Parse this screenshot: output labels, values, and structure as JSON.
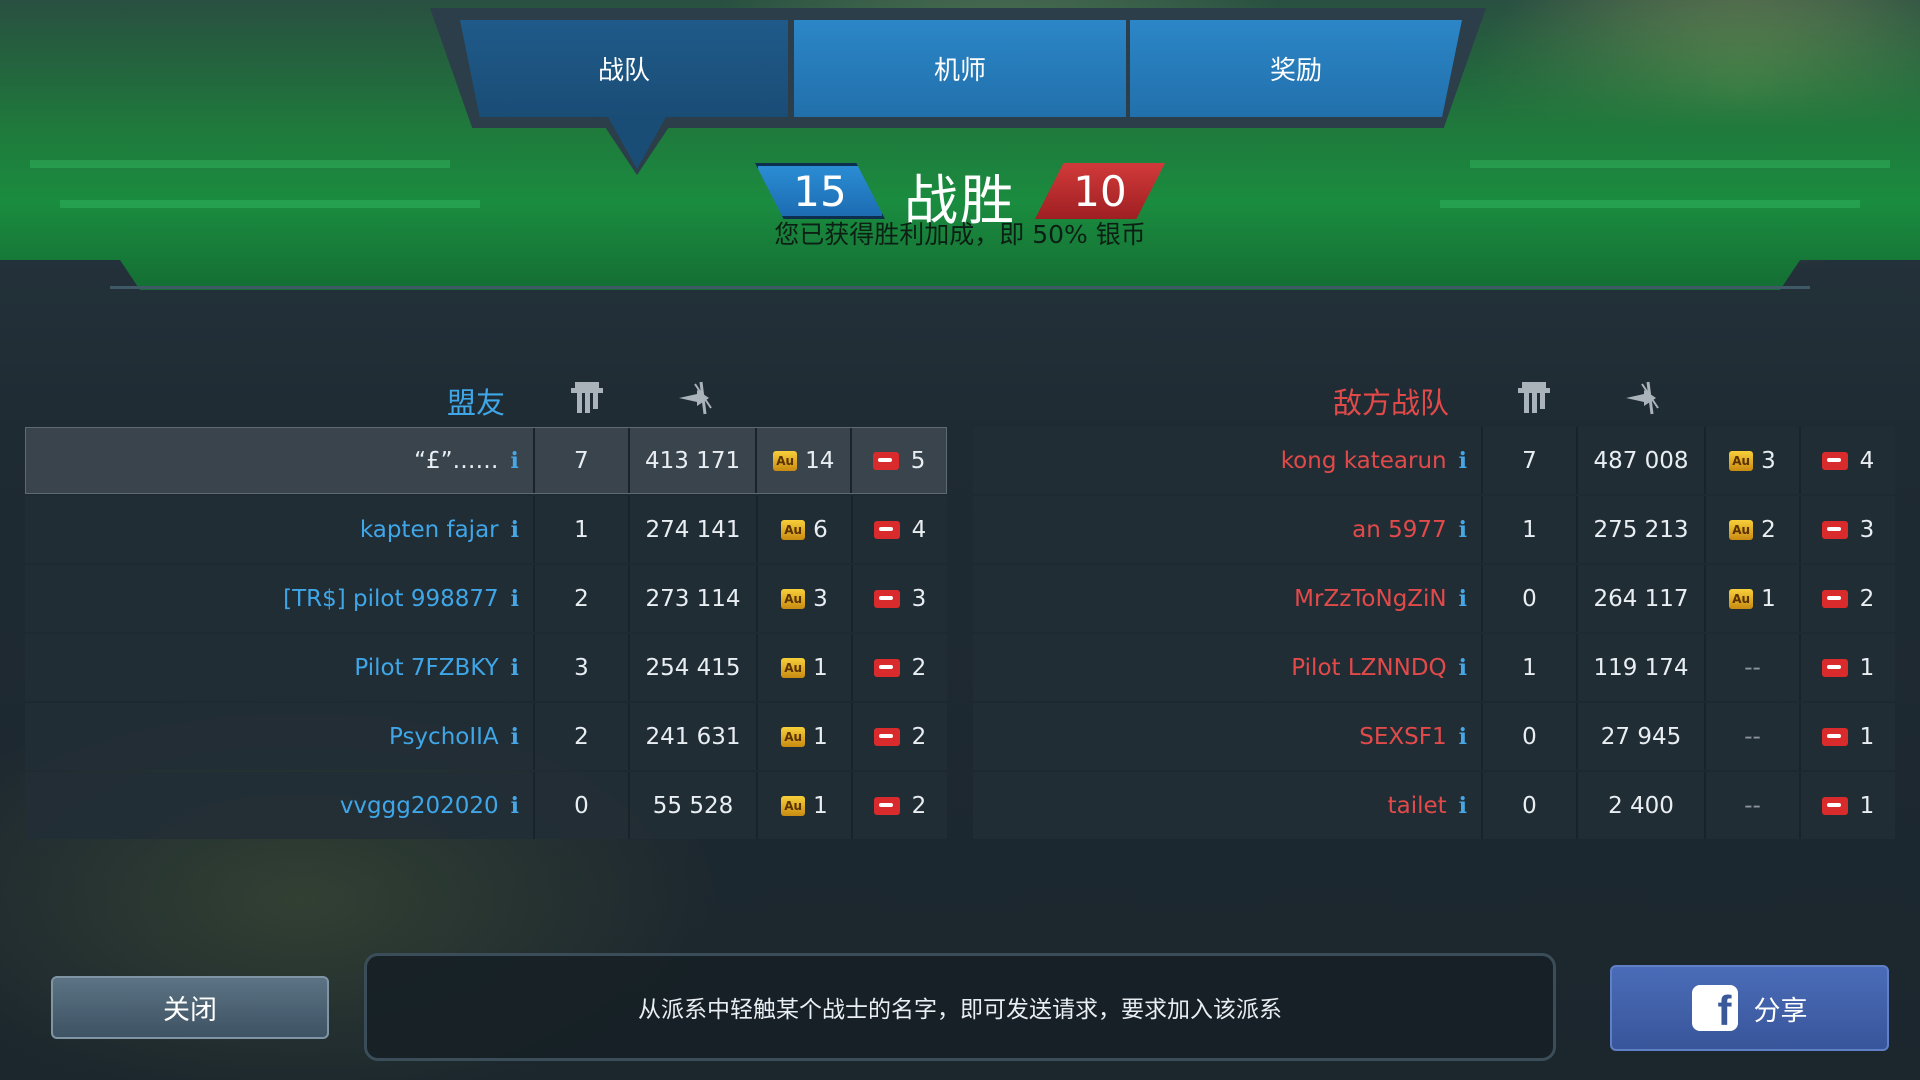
{
  "tabs": [
    {
      "label": "战队",
      "active": true
    },
    {
      "label": "机师",
      "active": false
    },
    {
      "label": "奖励",
      "active": false
    }
  ],
  "result": {
    "title": "战胜",
    "ally_score": "15",
    "enemy_score": "10",
    "subtitle": "您已获得胜利加成，即 50% 银币"
  },
  "allies": {
    "title": "盟友",
    "column_icons": [
      "turret-icon",
      "damage-icon"
    ],
    "rows": [
      {
        "name": "“£”……",
        "kills": "7",
        "damage": "413 171",
        "au": "14",
        "keys": "5",
        "highlight": true
      },
      {
        "name": "kapten fajar",
        "kills": "1",
        "damage": "274 141",
        "au": "6",
        "keys": "4"
      },
      {
        "name": "[TR$] pilot 998877",
        "kills": "2",
        "damage": "273 114",
        "au": "3",
        "keys": "3"
      },
      {
        "name": "Pilot 7FZBKY",
        "kills": "3",
        "damage": "254 415",
        "au": "1",
        "keys": "2"
      },
      {
        "name": "PsychoIIA",
        "kills": "2",
        "damage": "241 631",
        "au": "1",
        "keys": "2"
      },
      {
        "name": "vvggg202020",
        "kills": "0",
        "damage": "55 528",
        "au": "1",
        "keys": "2"
      }
    ]
  },
  "enemies": {
    "title": "敌方战队",
    "column_icons": [
      "turret-icon",
      "damage-icon"
    ],
    "rows": [
      {
        "name": "kong katearun",
        "kills": "7",
        "damage": "487 008",
        "au": "3",
        "keys": "4"
      },
      {
        "name": "an 5977",
        "kills": "1",
        "damage": "275 213",
        "au": "2",
        "keys": "3"
      },
      {
        "name": "MrZzToNgZiN",
        "kills": "0",
        "damage": "264 117",
        "au": "1",
        "keys": "2"
      },
      {
        "name": "Pilot LZNNDQ",
        "kills": "1",
        "damage": "119 174",
        "au": "--",
        "keys": "1"
      },
      {
        "name": "SEXSF1",
        "kills": "0",
        "damage": "27 945",
        "au": "--",
        "keys": "1"
      },
      {
        "name": "tailet",
        "kills": "0",
        "damage": "2 400",
        "au": "--",
        "keys": "1"
      }
    ]
  },
  "icons": {
    "au_label": "Au",
    "info_label": "i",
    "fb_label": "f"
  },
  "footer": {
    "close_label": "关闭",
    "hint": "从派系中轻触某个战士的名字，即可发送请求，要求加入该派系",
    "share_label": "分享"
  },
  "colors": {
    "ally": "#3fa6e8",
    "enemy": "#e24a4a",
    "banner": "#1a8c3f"
  }
}
